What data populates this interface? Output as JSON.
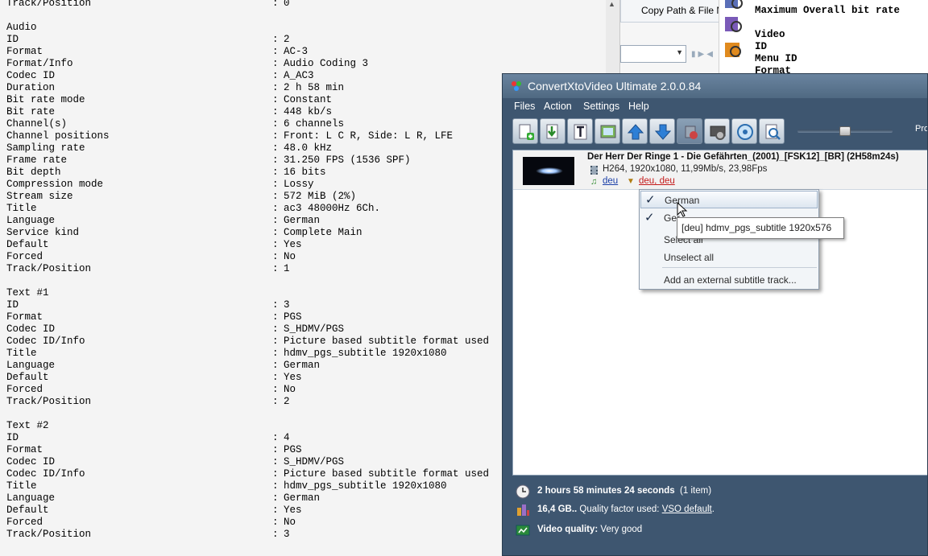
{
  "mediainfo": {
    "rows": [
      {
        "key": "Track/Position",
        "val": "0"
      },
      {
        "key": "",
        "val": ""
      },
      {
        "key": "Audio",
        "val": ""
      },
      {
        "key": "ID",
        "val": "2"
      },
      {
        "key": "Format",
        "val": "AC-3"
      },
      {
        "key": "Format/Info",
        "val": "Audio Coding 3"
      },
      {
        "key": "Codec ID",
        "val": "A_AC3"
      },
      {
        "key": "Duration",
        "val": "2 h 58 min"
      },
      {
        "key": "Bit rate mode",
        "val": "Constant"
      },
      {
        "key": "Bit rate",
        "val": "448 kb/s"
      },
      {
        "key": "Channel(s)",
        "val": "6 channels"
      },
      {
        "key": "Channel positions",
        "val": "Front: L C R, Side: L R, LFE"
      },
      {
        "key": "Sampling rate",
        "val": "48.0 kHz"
      },
      {
        "key": "Frame rate",
        "val": "31.250 FPS (1536 SPF)"
      },
      {
        "key": "Bit depth",
        "val": "16 bits"
      },
      {
        "key": "Compression mode",
        "val": "Lossy"
      },
      {
        "key": "Stream size",
        "val": "572 MiB (2%)"
      },
      {
        "key": "Title",
        "val": "ac3 48000Hz 6Ch."
      },
      {
        "key": "Language",
        "val": "German"
      },
      {
        "key": "Service kind",
        "val": "Complete Main"
      },
      {
        "key": "Default",
        "val": "Yes"
      },
      {
        "key": "Forced",
        "val": "No"
      },
      {
        "key": "Track/Position",
        "val": "1"
      },
      {
        "key": "",
        "val": ""
      },
      {
        "key": "Text #1",
        "val": ""
      },
      {
        "key": "ID",
        "val": "3"
      },
      {
        "key": "Format",
        "val": "PGS"
      },
      {
        "key": "Codec ID",
        "val": "S_HDMV/PGS"
      },
      {
        "key": "Codec ID/Info",
        "val": "Picture based subtitle format used"
      },
      {
        "key": "Title",
        "val": "hdmv_pgs_subtitle 1920x1080"
      },
      {
        "key": "Language",
        "val": "German"
      },
      {
        "key": "Default",
        "val": "Yes"
      },
      {
        "key": "Forced",
        "val": "No"
      },
      {
        "key": "Track/Position",
        "val": "2"
      },
      {
        "key": "",
        "val": ""
      },
      {
        "key": "Text #2",
        "val": ""
      },
      {
        "key": "ID",
        "val": "4"
      },
      {
        "key": "Format",
        "val": "PGS"
      },
      {
        "key": "Codec ID",
        "val": "S_HDMV/PGS"
      },
      {
        "key": "Codec ID/Info",
        "val": "Picture based subtitle format used"
      },
      {
        "key": "Title",
        "val": "hdmv_pgs_subtitle 1920x1080"
      },
      {
        "key": "Language",
        "val": "German"
      },
      {
        "key": "Default",
        "val": "Yes"
      },
      {
        "key": "Forced",
        "val": "No"
      },
      {
        "key": "Track/Position",
        "val": "3"
      }
    ],
    "separator": ":"
  },
  "bg_window": {
    "copy_path_label": "Copy Path & File N",
    "panel_lines": [
      "Maximum Overall bit rate",
      "",
      "Video",
      "ID",
      "Menu ID",
      "Format"
    ]
  },
  "app": {
    "title": "ConvertXtoVideo Ultimate 2.0.0.84",
    "menus": [
      "Files",
      "Action",
      "Settings",
      "Help"
    ],
    "toolbar_icons": [
      "add-file-icon",
      "add-folder-icon",
      "add-text-icon",
      "add-picture-icon",
      "move-up-icon",
      "move-down-icon",
      "convert-icon",
      "settings-icon",
      "burn-icon",
      "preview-icon"
    ],
    "slider_value": 0.5,
    "progress_label": "Pro"
  },
  "file": {
    "name": "Der Herr Der Ringe 1 - Die Gefährten_(2001)_[FSK12]_[BR] (2H58m24s)",
    "video_info": "H264, 1920x1080, 11,99Mb/s, 23,98Fps",
    "audio_lang": "deu",
    "subtitle_langs": "deu, deu"
  },
  "context_menu": {
    "items": [
      "German",
      "German",
      "Select all",
      "Unselect all",
      "Add an external subtitle track..."
    ],
    "checked": [
      true,
      true,
      false,
      false,
      false
    ],
    "item_2_visible": "Ger",
    "item_3_visible": "Select all"
  },
  "tooltip": "[deu] hdmv_pgs_subtitle 1920x576",
  "status": {
    "duration": "2 hours 58 minutes 24 seconds",
    "items_count": "(1 item)",
    "size": "16,4 GB..",
    "quality_text": "Quality factor used:",
    "quality_link": "VSO default",
    "quality_end": ".",
    "video_quality_label": "Video quality:",
    "video_quality_value": "Very good"
  },
  "colors": {
    "window_bg": "#3e5670",
    "title_bg": "#5f7a95",
    "link_blue": "#1a3fa8",
    "link_red": "#c41a1a"
  }
}
